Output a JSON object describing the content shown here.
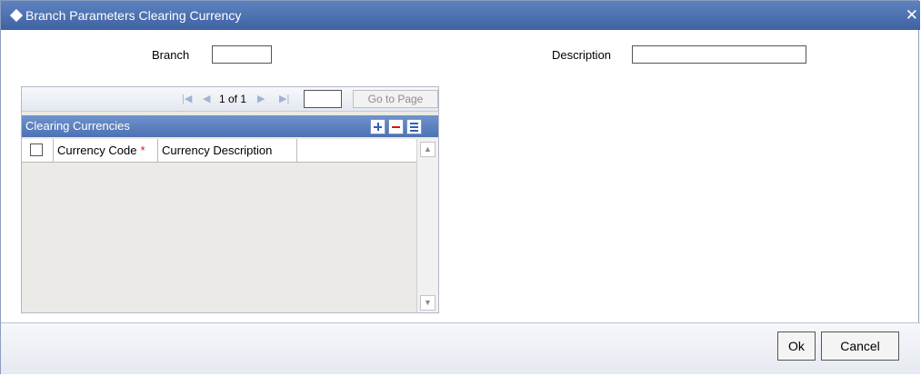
{
  "window": {
    "title": "Branch Parameters Clearing Currency",
    "close_symbol": "✕"
  },
  "form": {
    "branch_label": "Branch",
    "branch_value": "",
    "description_label": "Description",
    "description_value": ""
  },
  "pager": {
    "page_text": "1 of 1",
    "page_input_value": "",
    "goto_label": "Go to Page",
    "icons": [
      "first-page-icon",
      "prev-page-icon",
      "next-page-icon",
      "last-page-icon"
    ]
  },
  "grid": {
    "title": "Clearing Currencies",
    "columns": [
      {
        "label": "Currency Code",
        "required": true
      },
      {
        "label": "Currency Description",
        "required": false
      }
    ],
    "required_marker": "*",
    "rows": []
  },
  "footer": {
    "ok_label": "Ok",
    "cancel_label": "Cancel"
  },
  "colors": {
    "titlebar": "#3f62a3",
    "section_header": "#4d71b3",
    "required": "#d01818"
  }
}
